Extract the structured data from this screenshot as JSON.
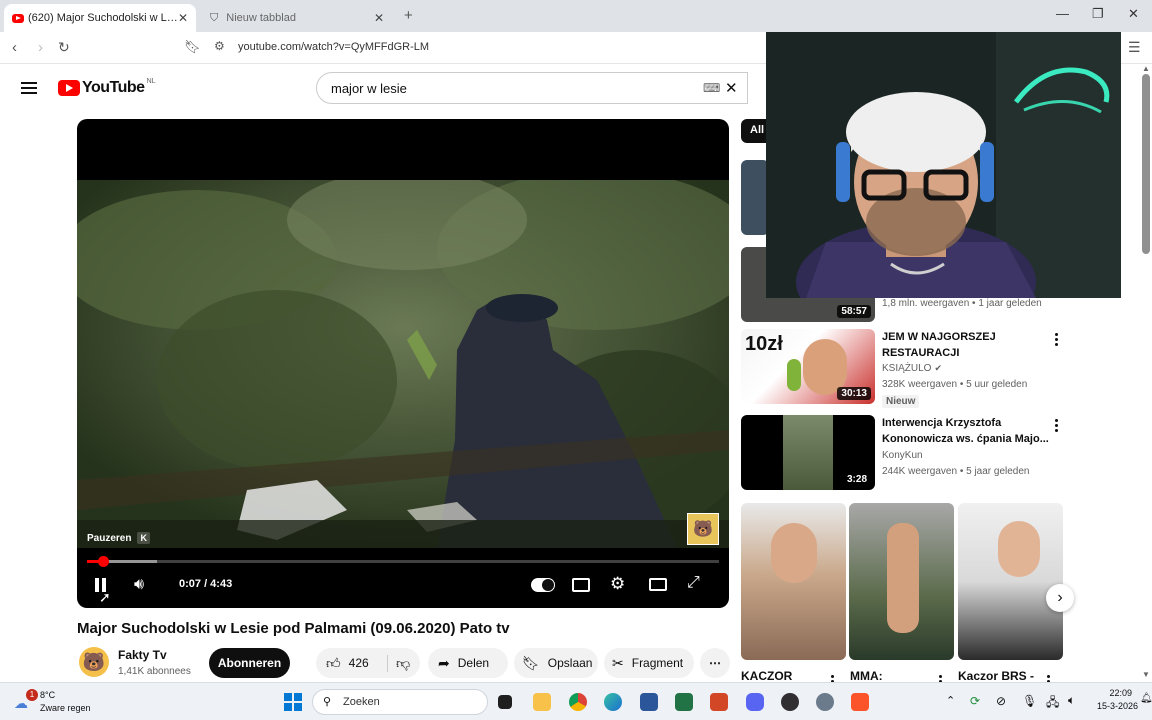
{
  "browser": {
    "tabs": [
      {
        "title": "(620) Major Suchodolski w Lesie pod Palmami",
        "active": true
      },
      {
        "title": "Nieuw tabblad",
        "active": false
      }
    ],
    "url": "youtube.com/watch?v=QyMFFdGR-LM"
  },
  "masthead": {
    "logo_text": "YouTube",
    "region": "NL",
    "search_value": "major w lesie"
  },
  "player": {
    "current_time": "0:07",
    "duration": "4:43",
    "time_display": "0:07 / 4:43",
    "progress_fraction": 0.025,
    "buffer_fraction": 0.11,
    "tooltip": "Pauzeren",
    "tooltip_key": "K"
  },
  "video": {
    "title": "Major Suchodolski w Lesie pod Palmami (09.06.2020) Pato tv",
    "channel": "Fakty Tv",
    "subscribers": "1,41K abonnees",
    "subscribe_label": "Abonneren",
    "likes": "426",
    "share_label": "Delen",
    "save_label": "Opslaan",
    "clip_label": "Fragment"
  },
  "sidebar": {
    "chip_label": "All",
    "recommendations": [
      {
        "duration": "",
        "title": "",
        "meta": ""
      },
      {
        "duration": "58:57",
        "title": "",
        "meta": "1,8 mln. weergaven • 1 jaar geleden"
      },
      {
        "duration": "30:13",
        "title": "JEM W NAJGORSZEJ RESTAURACJI",
        "channel": "KSIĄŻULO",
        "meta": "328K weergaven • 5 uur geleden",
        "badge": "Nieuw",
        "thumb_text": "10zł"
      },
      {
        "duration": "3:28",
        "title": "Interwencja Krzysztofa Kononowicza ws. ćpania Majo...",
        "channel": "KonyKun",
        "meta": "244K weergaven • 5 jaar geleden"
      }
    ],
    "shorts": [
      {
        "title": "KACZOR"
      },
      {
        "title": "MMA:"
      },
      {
        "title": "Kaczor BRS -"
      }
    ]
  },
  "taskbar": {
    "weather_temp": "8°C",
    "weather_desc": "Zware regen",
    "search_placeholder": "Zoeken",
    "time": "22:09",
    "date": "15-3-2026",
    "notification_count": "1"
  },
  "colors": {
    "yt_red": "#ff0000",
    "tab_bar": "#dfe3e8",
    "taskbar": "#eef1f6"
  }
}
